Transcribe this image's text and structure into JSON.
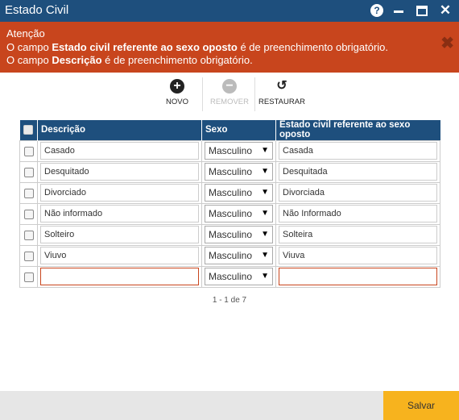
{
  "window": {
    "title": "Estado Civil"
  },
  "titlebar": {
    "help_glyph": "?",
    "close_glyph": "✕"
  },
  "alert": {
    "heading": "Atenção",
    "line1_pre": "O campo ",
    "line1_bold": "Estado civil referente ao sexo oposto",
    "line1_post": " é de preenchimento obrigatório.",
    "line2_pre": "O campo ",
    "line2_bold": "Descrição",
    "line2_post": " é de preenchimento obrigatório.",
    "close_glyph": "✖"
  },
  "toolbar": {
    "novo": {
      "label": "NOVO",
      "icon": "plus-circle-icon",
      "glyph": "+"
    },
    "remover": {
      "label": "REMOVER",
      "icon": "minus-circle-icon",
      "glyph": "−"
    },
    "restaurar": {
      "label": "RESTAURAR",
      "icon": "restore-icon",
      "glyph": "↺"
    }
  },
  "grid": {
    "headers": {
      "descricao": "Descrição",
      "sexo": "Sexo",
      "oposto": "Estado civil referente ao sexo oposto"
    },
    "rows": [
      {
        "descricao": "Casado",
        "sexo": "Masculino",
        "oposto": "Casada"
      },
      {
        "descricao": "Desquitado",
        "sexo": "Masculino",
        "oposto": "Desquitada"
      },
      {
        "descricao": "Divorciado",
        "sexo": "Masculino",
        "oposto": "Divorciada"
      },
      {
        "descricao": "Não informado",
        "sexo": "Masculino",
        "oposto": "Não Informado"
      },
      {
        "descricao": "Solteiro",
        "sexo": "Masculino",
        "oposto": "Solteira"
      },
      {
        "descricao": "Viuvo",
        "sexo": "Masculino",
        "oposto": " Viuva"
      },
      {
        "descricao": "",
        "sexo": "Masculino",
        "oposto": ""
      }
    ],
    "dropdown_arrow": "▼"
  },
  "pager": {
    "text": "1 - 1 de 7"
  },
  "footer": {
    "save_label": "Salvar"
  },
  "colors": {
    "header": "#1e4f7d",
    "alert": "#c8451d",
    "save": "#f7b31e"
  }
}
